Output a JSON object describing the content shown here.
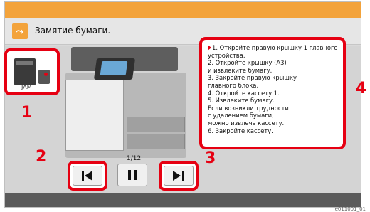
{
  "header": {
    "title": "Замятие бумаги.",
    "alert_icon": "paper-jam-icon"
  },
  "thumbnail": {
    "label": "JAM"
  },
  "instructions": {
    "lines": [
      "1. Откройте правую крышку 1 главного",
      "устройства.",
      "2. Откройте крышку (A3)",
      "и извлеките бумагу.",
      "3. Закройте правую крышку",
      "главного блока.",
      "4. Откройте кассету 1.",
      "5. Извлеките бумагу.",
      "Если возникли трудности",
      "с удалением бумаги,",
      "можно извлечь кассету.",
      "6. Закройте кассету."
    ]
  },
  "pager": {
    "counter": "1/12"
  },
  "callouts": {
    "c1": "1",
    "c2": "2",
    "c3": "3",
    "c4": "4"
  },
  "footer": {
    "code": "e011001_01"
  },
  "colors": {
    "accent": "#f3a33b",
    "highlight": "#e60012"
  }
}
